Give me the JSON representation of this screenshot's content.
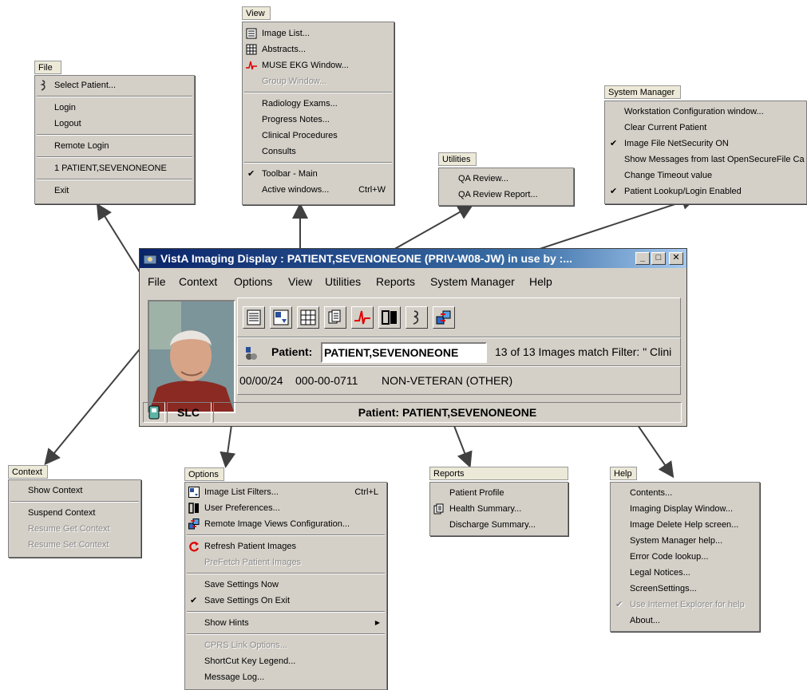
{
  "menus": {
    "file": {
      "title": "File",
      "items": [
        {
          "label": "Select Patient...",
          "icon": "select-patient-icon"
        },
        {
          "label": "Login"
        },
        {
          "label": "Logout"
        },
        {
          "label": "Remote Login"
        },
        {
          "label": "1 PATIENT,SEVENONEONE"
        },
        {
          "label": "Exit"
        }
      ]
    },
    "view": {
      "title": "View",
      "items": [
        {
          "label": "Image List...",
          "icon": "image-list-icon"
        },
        {
          "label": "Abstracts...",
          "icon": "abstracts-icon"
        },
        {
          "label": "MUSE EKG Window...",
          "icon": "ekg-icon"
        },
        {
          "label": "Group Window...",
          "disabled": true
        },
        {
          "label": "Radiology Exams..."
        },
        {
          "label": "Progress Notes..."
        },
        {
          "label": "Clinical Procedures"
        },
        {
          "label": "Consults"
        },
        {
          "label": "Toolbar - Main",
          "checked": true
        },
        {
          "label": "Active windows...",
          "shortcut": "Ctrl+W"
        }
      ]
    },
    "utilities": {
      "title": "Utilities",
      "items": [
        {
          "label": "QA Review..."
        },
        {
          "label": "QA Review Report..."
        }
      ]
    },
    "system_manager": {
      "title": "System Manager",
      "items": [
        {
          "label": "Workstation Configuration window..."
        },
        {
          "label": "Clear Current Patient"
        },
        {
          "label": "Image File NetSecurity ON",
          "checked": true
        },
        {
          "label": "Show Messages from last OpenSecureFile Ca"
        },
        {
          "label": "Change Timeout value"
        },
        {
          "label": "Patient Lookup/Login Enabled",
          "checked": true
        }
      ]
    },
    "context": {
      "title": "Context",
      "items": [
        {
          "label": "Show Context"
        },
        {
          "label": "Suspend Context"
        },
        {
          "label": "Resume Get Context",
          "disabled": true
        },
        {
          "label": "Resume Set Context",
          "disabled": true
        }
      ]
    },
    "options": {
      "title": "Options",
      "items": [
        {
          "label": "Image List Filters...",
          "shortcut": "Ctrl+L",
          "icon": "filter-icon"
        },
        {
          "label": "User Preferences...",
          "icon": "preferences-icon"
        },
        {
          "label": "Remote Image Views Configuration...",
          "icon": "remote-views-icon"
        },
        {
          "label": "Refresh Patient Images",
          "icon": "refresh-icon"
        },
        {
          "label": "PreFetch Patient Images",
          "disabled": true
        },
        {
          "label": "Save Settings Now"
        },
        {
          "label": "Save Settings On Exit",
          "checked": true
        },
        {
          "label": "Show Hints"
        },
        {
          "label": "CPRS Link Options...",
          "disabled": true
        },
        {
          "label": "ShortCut Key Legend..."
        },
        {
          "label": "Message Log..."
        }
      ]
    },
    "reports": {
      "title": "Reports",
      "items": [
        {
          "label": "Patient Profile"
        },
        {
          "label": "Health Summary...",
          "icon": "health-summary-icon"
        },
        {
          "label": "Discharge Summary..."
        }
      ]
    },
    "help": {
      "title": "Help",
      "items": [
        {
          "label": "Contents..."
        },
        {
          "label": "Imaging Display Window..."
        },
        {
          "label": "Image Delete Help screen..."
        },
        {
          "label": "System Manager help..."
        },
        {
          "label": "Error Code lookup..."
        },
        {
          "label": "Legal Notices..."
        },
        {
          "label": "ScreenSettings..."
        },
        {
          "label": "Use Internet Explorer for help",
          "checked": true,
          "disabled": true
        },
        {
          "label": "About..."
        }
      ]
    }
  },
  "window": {
    "title": "VistA Imaging Display : PATIENT,SEVENONEONE (PRIV-W08-JW) in use by :...",
    "menubar": [
      "File",
      "Context",
      "Options",
      "View",
      "Utilities",
      "Reports",
      "System Manager",
      "Help"
    ],
    "patient_label": "Patient:",
    "patient_value": "PATIENT,SEVENONEONE",
    "filter_text": "13 of 13 Images match Filter: \" Clini",
    "dob": "00/00/24",
    "ssn": "000-00-0711",
    "status": "NON-VETERAN (OTHER)",
    "site": "SLC",
    "status_patient": "Patient: PATIENT,SEVENONEONE",
    "controls": {
      "minimize": "_",
      "maximize": "□",
      "close": "✕"
    }
  },
  "colors": {
    "menu_bg": "#d4d0c8",
    "title_bar": "#0a246a",
    "ekg_red": "#e00000"
  }
}
